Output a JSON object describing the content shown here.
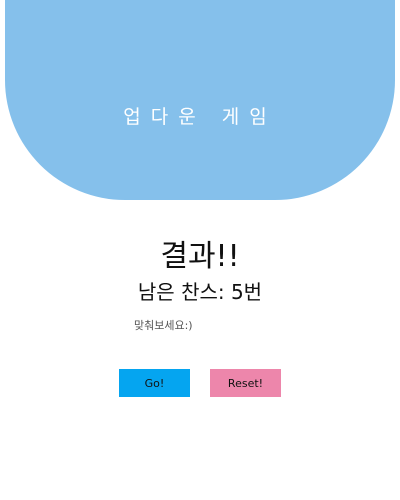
{
  "header": {
    "title": "업다운 게임"
  },
  "result": {
    "heading": "결과!!",
    "chances_label": "남은 찬스: 5번"
  },
  "hint": {
    "text": "맞춰보세요:)"
  },
  "buttons": {
    "go_label": "Go!",
    "reset_label": "Reset!"
  },
  "colors": {
    "header_bg": "#85c0eb",
    "go_bg": "#05a5f0",
    "reset_bg": "#ed86ab"
  }
}
